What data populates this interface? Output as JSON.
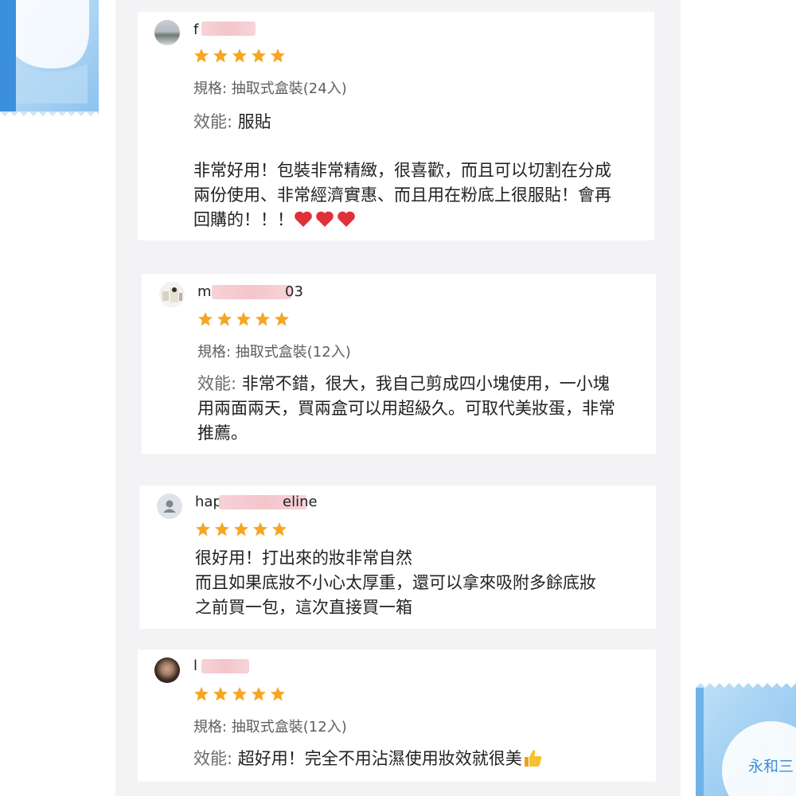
{
  "reviews": [
    {
      "username_visible": "f",
      "stars": 5,
      "spec": "規格: 抽取式盒裝(24入)",
      "efficacy_label": "效能:",
      "efficacy_value": "服貼",
      "body_lines": [
        "非常好用！包裝非常精緻，很喜歡，而且可以切割在分成",
        "兩份使用、非常經濟實惠、而且用在粉底上很服貼！會再",
        "回購的！！！"
      ],
      "emoji": "heart"
    },
    {
      "username_visible_prefix": "m",
      "username_visible_suffix": "03",
      "stars": 5,
      "spec": "規格: 抽取式盒裝(12入)",
      "efficacy_label": "效能:",
      "body_lines": [
        "非常不錯，很大，我自己剪成四小塊使用，一小塊",
        "用兩面兩天，買兩盒可以用超級久。可取代美妝蛋，非常",
        "推薦。"
      ]
    },
    {
      "username_visible_prefix": "hap",
      "username_visible_suffix": "eline",
      "stars": 5,
      "body_lines": [
        "很好用！打出來的妝非常自然",
        "而且如果底妝不小心太厚重，還可以拿來吸附多餘底妝",
        "之前買一包，這次直接買一箱"
      ]
    },
    {
      "username_visible": "l",
      "stars": 5,
      "spec": "規格: 抽取式盒裝(12入)",
      "efficacy_label": "效能:",
      "efficacy_value": "超好用！完全不用沾濕使用妝效就很美",
      "emoji": "thumbs-up"
    }
  ],
  "decor": {
    "product_text": "永和三"
  },
  "colors": {
    "star": "#f5a623",
    "heart": "#e0303a",
    "feed_bg": "#f3f2f5",
    "package_blue": "#8ec4ef"
  }
}
